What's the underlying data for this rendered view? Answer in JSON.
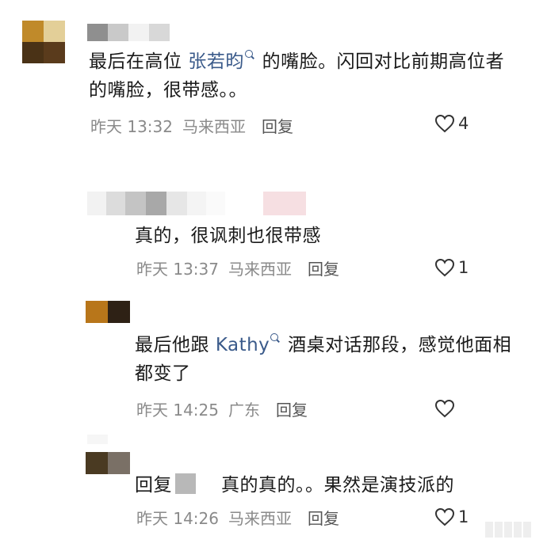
{
  "comments": [
    {
      "text_before": "最后在高位 ",
      "mention": "张若昀",
      "text_after": " 的嘴脸。闪回对比前期高位者",
      "text_line2": "的嘴脸，很带感。。",
      "time": "昨天 13:32",
      "location": "马来西亚",
      "reply_label": "回复",
      "likes": "4"
    },
    {
      "text": "真的，很讽刺也很带感",
      "time": "昨天 13:37",
      "location": "马来西亚",
      "reply_label": "回复",
      "likes": "1"
    },
    {
      "text_before": "最后他跟 ",
      "mention": "Kathy",
      "text_after": " 酒桌对话那段，感觉他面相",
      "text_line2": "都变了",
      "time": "昨天 14:25",
      "location": "广东",
      "reply_label": "回复"
    },
    {
      "reply_prefix": "回复",
      "text": "真的真的。。果然是演技派的",
      "time": "昨天 14:26",
      "location": "马来西亚",
      "reply_label": "回复",
      "likes": "1"
    }
  ],
  "icons": {
    "like": "heart-outline-icon",
    "mention": "search-mention-icon"
  },
  "colors": {
    "mention": "#3a5a8a",
    "meta": "#8a8a8a",
    "text": "#1a1a1a"
  }
}
